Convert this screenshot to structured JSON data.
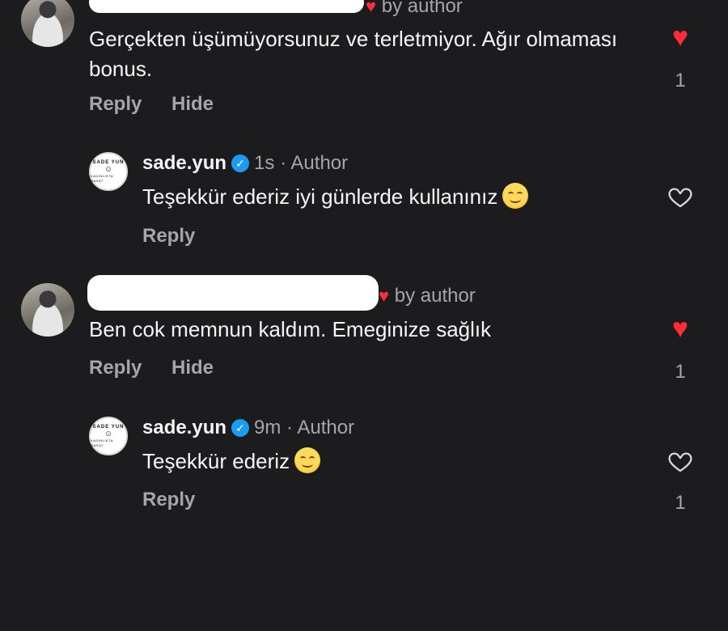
{
  "comments": [
    {
      "author_meta": "by author",
      "text": "Gerçekten üşümüyorsunuz ve terletmiyor. Ağır olmaması bonus.",
      "actions": {
        "reply": "Reply",
        "hide": "Hide"
      },
      "likes": "1",
      "liked": true,
      "reply": {
        "username": "sade.yun",
        "time": "1s",
        "role": "Author",
        "text": "Teşekkür ederiz iyi günlerde kullanınız",
        "reply_label": "Reply",
        "likes": "",
        "liked": false
      }
    },
    {
      "author_meta": "by author",
      "text": "Ben cok memnun kaldım. Emeginize sağlık",
      "actions": {
        "reply": "Reply",
        "hide": "Hide"
      },
      "likes": "1",
      "liked": true,
      "reply": {
        "username": "sade.yun",
        "time": "9m",
        "role": "Author",
        "text": "Teşekkür ederiz",
        "reply_label": "Reply",
        "likes": "1",
        "liked": false
      }
    }
  ],
  "brand_avatar": {
    "top": "SADE YUN",
    "bottom": "KADINLIKTA RAHAT"
  },
  "icons": {
    "liked": "heart-filled-icon",
    "unliked": "heart-outline-icon",
    "verified": "verified-badge-icon",
    "emoji": "smiling-face-emoji"
  },
  "colors": {
    "background": "#1c1c1e",
    "accent_red": "#ff2d3a",
    "verified_blue": "#1d9bf0",
    "muted": "#a5a5aa"
  }
}
